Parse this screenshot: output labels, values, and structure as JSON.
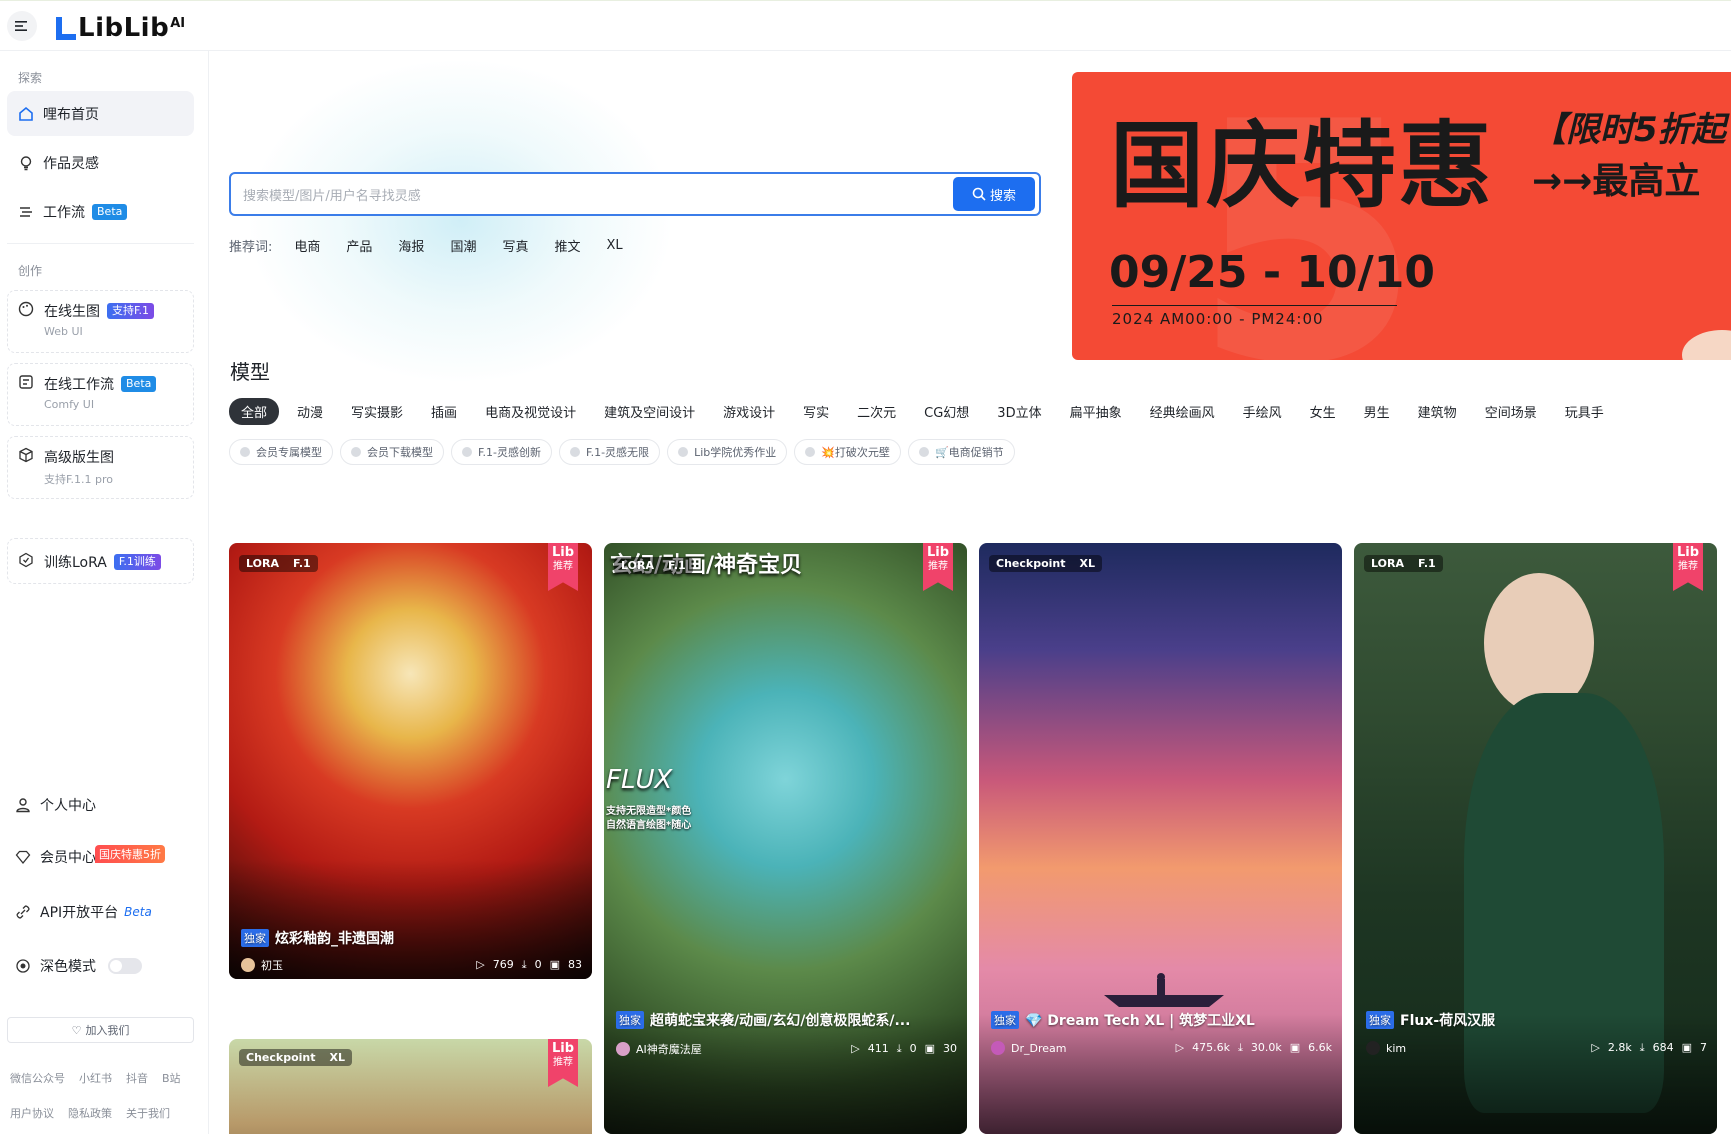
{
  "brand": {
    "logo_text": "LibLib",
    "logo_ai": "AI"
  },
  "sidebar": {
    "explore_label": "探索",
    "items": [
      {
        "label": "哩布首页",
        "icon": "home-icon"
      },
      {
        "label": "作品灵感",
        "icon": "bulb-icon"
      },
      {
        "label": "工作流",
        "badge": "Beta",
        "icon": "workflow-icon"
      }
    ],
    "create_label": "创作",
    "create_items": [
      {
        "label": "在线生图",
        "badge": "支持F.1",
        "sub": "Web UI",
        "icon": "palette-icon"
      },
      {
        "label": "在线工作流",
        "badge": "Beta",
        "sub": "Comfy UI",
        "icon": "comfy-icon"
      },
      {
        "label": "高级版生图",
        "sub": "支持F.1.1 pro",
        "icon": "cube-icon"
      },
      {
        "label": "训练LoRA",
        "badge": "F.1训练",
        "icon": "train-icon"
      }
    ],
    "bottom_items": [
      {
        "label": "个人中心",
        "icon": "user-icon"
      },
      {
        "label": "会员中心",
        "hot": "国庆特惠5折",
        "icon": "diamond-icon"
      },
      {
        "label": "API开放平台",
        "badge": "Beta",
        "icon": "api-icon"
      },
      {
        "label": "深色模式",
        "icon": "theme-icon"
      }
    ],
    "join": "加入我们",
    "footer_row1": [
      "微信公众号",
      "小红书",
      "抖音",
      "B站"
    ],
    "footer_row2": [
      "用户协议",
      "隐私政策",
      "关于我们"
    ]
  },
  "search": {
    "placeholder": "搜索模型/图片/用户名寻找灵感",
    "button": "搜索"
  },
  "recommend": {
    "label": "推荐词:",
    "words": [
      "电商",
      "产品",
      "海报",
      "国潮",
      "写真",
      "推文",
      "XL"
    ]
  },
  "banner": {
    "title": "国庆特惠",
    "subtitle": "【限时5折起",
    "cta": "→→最高立",
    "date": "09/25 - 10/10",
    "time": "2024  AM00:00 - PM24:00",
    "bg_color": "#f44a35"
  },
  "models": {
    "title": "模型",
    "categories": [
      "全部",
      "动漫",
      "写实摄影",
      "插画",
      "电商及视觉设计",
      "建筑及空间设计",
      "游戏设计",
      "写实",
      "二次元",
      "CG幻想",
      "3D立体",
      "扁平抽象",
      "经典绘画风",
      "手绘风",
      "女生",
      "男生",
      "建筑物",
      "空间场景",
      "玩具手"
    ],
    "chips": [
      "会员专属模型",
      "会员下载模型",
      "F.1-灵感创新",
      "F.1-灵感无限",
      "Lib学院优秀作业",
      "💥打破次元壁",
      "🛒电商促销节"
    ]
  },
  "cards": [
    {
      "tags": [
        "LORA",
        "F.1"
      ],
      "rec": true,
      "exclusive": "独家",
      "title": "炫彩釉韵_非遗国潮",
      "author": "初玉",
      "runs": "769",
      "downloads": "0",
      "images": "83"
    },
    {
      "tags": [
        "LORA",
        "F.1"
      ],
      "rec": true,
      "exclusive": "独家",
      "title": "超萌蛇宝来袭/动画/玄幻/创意极限蛇系/...",
      "author": "AI神奇魔法屋",
      "runs": "411",
      "downloads": "0",
      "images": "30",
      "overlay_top": "玄幻/动画/神奇宝贝",
      "overlay_flux": "FLUX",
      "overlay_sub1": "支持无限造型*颜色",
      "overlay_sub2": "自然语言绘图*随心"
    },
    {
      "tags": [
        "Checkpoint",
        "XL"
      ],
      "rec": false,
      "exclusive": "独家",
      "title": "💎 Dream Tech XL | 筑梦工业XL",
      "author": "Dr_Dream",
      "runs": "475.6k",
      "downloads": "30.0k",
      "images": "6.6k"
    },
    {
      "tags": [
        "LORA",
        "F.1"
      ],
      "rec": true,
      "exclusive": "独家",
      "title": "Flux-荷风汉服",
      "author": "kim",
      "runs": "2.8k",
      "downloads": "684",
      "images": "7"
    },
    {
      "tags": [
        "Checkpoint",
        "XL"
      ],
      "rec": true
    }
  ],
  "ribbon": {
    "lib": "Lib",
    "text": "推荐"
  },
  "icons": {
    "play": "▷",
    "download": "⤓",
    "image": "▣"
  }
}
